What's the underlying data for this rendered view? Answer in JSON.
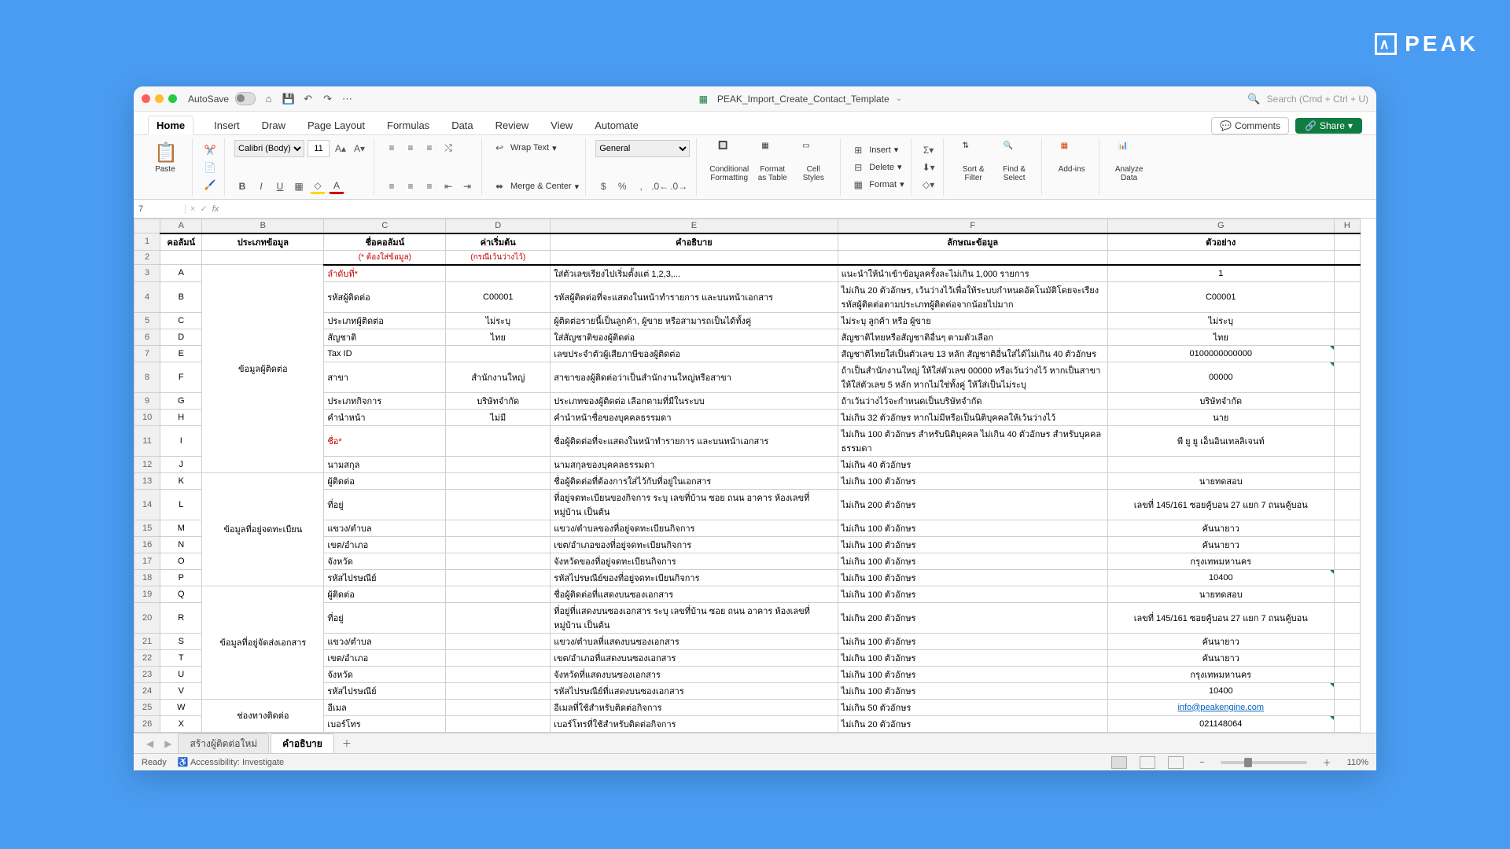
{
  "brand": "PEAK",
  "titlebar": {
    "autosave": "AutoSave",
    "filename": "PEAK_Import_Create_Contact_Template",
    "search_placeholder": "Search (Cmd + Ctrl + U)"
  },
  "menu": {
    "tabs": [
      "Home",
      "Insert",
      "Draw",
      "Page Layout",
      "Formulas",
      "Data",
      "Review",
      "View",
      "Automate"
    ],
    "comments": "Comments",
    "share": "Share"
  },
  "ribbon": {
    "paste": "Paste",
    "font_name": "Calibri (Body)",
    "font_size": "11",
    "wrap_text": "Wrap Text",
    "merge_center": "Merge & Center",
    "number_format": "General",
    "cond_fmt": "Conditional\nFormatting",
    "fmt_table": "Format\nas Table",
    "cell_styles": "Cell\nStyles",
    "insert": "Insert",
    "delete": "Delete",
    "format": "Format",
    "sort_filter": "Sort &\nFilter",
    "find_select": "Find &\nSelect",
    "addins": "Add-ins",
    "analyze": "Analyze\nData"
  },
  "fxbar": {
    "cell": "7",
    "fx": "fx"
  },
  "col_letters": [
    "",
    "A",
    "B",
    "C",
    "D",
    "E",
    "F",
    "G",
    "H"
  ],
  "header1": {
    "a": "คอลัมน์",
    "b": "ประเภทข้อมูล",
    "c": "ชื่อคอลัมน์",
    "d": "ค่าเริ่มต้น",
    "e": "คำอธิบาย",
    "f": "ลักษณะข้อมูล",
    "g": "ตัวอย่าง"
  },
  "header2": {
    "c": "(* ต้องใส่ข้อมูล)",
    "d": "(กรณีเว้นว่างไว้)"
  },
  "groups": {
    "g1": "ข้อมูลผู้ติดต่อ",
    "g2": "ข้อมูลที่อยู่จดทะเบียน",
    "g3": "ข้อมูลที่อยู่จัดส่งเอกสาร",
    "g4": "ช่องทางติดต่อ"
  },
  "rows": [
    {
      "a": "A",
      "c": "ลำดับที่*",
      "c_red": true,
      "d": "",
      "e": "ใส่ตัวเลขเรียงไปเริ่มตั้งแต่ 1,2,3,...",
      "f": "แนะนำให้นำเข้าข้อมูลครั้งละไม่เกิน 1,000 รายการ",
      "g": "1"
    },
    {
      "a": "B",
      "c": "รหัสผู้ติดต่อ",
      "d": "C00001",
      "e": "รหัสผู้ติดต่อที่จะแสดงในหน้าทำรายการ และบนหน้าเอกสาร",
      "f": "ไม่เกิน 20 ตัวอักษร, เว้นว่างไว้เพื่อให้ระบบกำหนดอัตโนมัติโดยจะเรียงรหัสผู้ติดต่อตามประเภทผู้ติดต่อจากน้อยไปมาก",
      "g": "C00001"
    },
    {
      "a": "C",
      "c": "ประเภทผู้ติดต่อ",
      "d": "ไม่ระบุ",
      "e": "ผู้ติดต่อรายนี้เป็นลูกค้า, ผู้ขาย หรือสามารถเป็นได้ทั้งคู่",
      "f": "ไม่ระบุ ลูกค้า หรือ ผู้ขาย",
      "g": "ไม่ระบุ"
    },
    {
      "a": "D",
      "c": "สัญชาติ",
      "d": "ไทย",
      "e": "ใส่สัญชาติของผู้ติดต่อ",
      "f": "สัญชาติไทยหรือสัญชาติอื่นๆ ตามตัวเลือก",
      "g": "ไทย"
    },
    {
      "a": "E",
      "c": "Tax ID",
      "d": "",
      "e": "เลขประจำตัวผู้เสียภาษีของผู้ติดต่อ",
      "f": "สัญชาติไทยใส่เป็นตัวเลข 13 หลัก สัญชาติอื่นใส่ได้ไม่เกิน 40 ตัวอักษร",
      "g": "0100000000000",
      "tri": true
    },
    {
      "a": "F",
      "c": "สาขา",
      "d": "สำนักงานใหญ่",
      "e": "สาขาของผู้ติดต่อว่าเป็นสำนักงานใหญ่หรือสาขา",
      "f": "ถ้าเป็นสำนักงานใหญ่ ให้ใส่ตัวเลข 00000 หรือเว้นว่างไว้ หากเป็นสาขา ให้ใส่ตัวเลข 5 หลัก หากไม่ใช่ทั้งคู่ ให้ใส่เป็นไม่ระบุ",
      "g": "00000",
      "tri": true
    },
    {
      "a": "G",
      "c": "ประเภทกิจการ",
      "d": "บริษัทจำกัด",
      "e": "ประเภทของผู้ติดต่อ เลือกตามที่มีในระบบ",
      "f": "ถ้าเว้นว่างไว้จะกำหนดเป็นบริษัทจำกัด",
      "g": "บริษัทจำกัด"
    },
    {
      "a": "H",
      "c": "คำนำหน้า",
      "d": "ไม่มี",
      "e": "คำนำหน้าชื่อของบุคคลธรรมดา",
      "f": "ไม่เกิน 32 ตัวอักษร หากไม่มีหรือเป็นนิติบุคคลให้เว้นว่างไว้",
      "g": "นาย"
    },
    {
      "a": "I",
      "c": "ชื่อ*",
      "c_red": true,
      "d": "",
      "e": "ชื่อผู้ติดต่อที่จะแสดงในหน้าทำรายการ และบนหน้าเอกสาร",
      "f": "ไม่เกิน 100 ตัวอักษร สำหรับนิติบุคคล ไม่เกิน 40 ตัวอักษร สำหรับบุคคลธรรมดา",
      "g": "พี ยู ยู เอ็นอินเทลลิเจนท์"
    },
    {
      "a": "J",
      "c": "นามสกุล",
      "d": "",
      "e": "นามสกุลของบุคคลธรรมดา",
      "f": "ไม่เกิน 40 ตัวอักษร",
      "g": ""
    },
    {
      "a": "K",
      "c": "ผู้ติดต่อ",
      "d": "",
      "e": "ชื่อผู้ติดต่อที่ต้องการใส่ไว้กับที่อยู่ในเอกสาร",
      "f": "ไม่เกิน 100 ตัวอักษร",
      "g": "นายทดสอบ"
    },
    {
      "a": "L",
      "c": "ที่อยู่",
      "d": "",
      "e": "ที่อยู่จดทะเบียนของกิจการ ระบุ เลขที่บ้าน ซอย ถนน อาคาร ห้องเลขที่ หมู่บ้าน เป็นต้น",
      "f": "ไม่เกิน 200 ตัวอักษร",
      "g": "เลขที่ 145/161 ซอยคู้บอน 27 แยก 7 ถนนคู้บอน"
    },
    {
      "a": "M",
      "c": "แขวง/ตำบล",
      "d": "",
      "e": "แขวง/ตำบลของที่อยู่จดทะเบียนกิจการ",
      "f": "ไม่เกิน 100 ตัวอักษร",
      "g": "คันนายาว"
    },
    {
      "a": "N",
      "c": "เขต/อำเภอ",
      "d": "",
      "e": "เขต/อำเภอของที่อยู่จดทะเบียนกิจการ",
      "f": "ไม่เกิน 100 ตัวอักษร",
      "g": "คันนายาว"
    },
    {
      "a": "O",
      "c": "จังหวัด",
      "d": "",
      "e": "จังหวัดของที่อยู่จดทะเบียนกิจการ",
      "f": "ไม่เกิน 100 ตัวอักษร",
      "g": "กรุงเทพมหานคร"
    },
    {
      "a": "P",
      "c": "รหัสไปรษณีย์",
      "d": "",
      "e": "รหัสไปรษณีย์ของที่อยู่จดทะเบียนกิจการ",
      "f": "ไม่เกิน 100 ตัวอักษร",
      "g": "10400",
      "tri": true
    },
    {
      "a": "Q",
      "c": "ผู้ติดต่อ",
      "d": "",
      "e": "ชื่อผู้ติดต่อที่แสดงบนซองเอกสาร",
      "f": "ไม่เกิน 100 ตัวอักษร",
      "g": "นายทดสอบ"
    },
    {
      "a": "R",
      "c": "ที่อยู่",
      "d": "",
      "e": "ที่อยู่ที่แสดงบนซองเอกสาร ระบุ เลขที่บ้าน ซอย ถนน อาคาร ห้องเลขที่ หมู่บ้าน เป็นต้น",
      "f": "ไม่เกิน 200 ตัวอักษร",
      "g": "เลขที่ 145/161 ซอยคู้บอน 27 แยก 7 ถนนคู้บอน"
    },
    {
      "a": "S",
      "c": "แขวง/ตำบล",
      "d": "",
      "e": "แขวง/ตำบลที่แสดงบนซองเอกสาร",
      "f": "ไม่เกิน 100 ตัวอักษร",
      "g": "คันนายาว"
    },
    {
      "a": "T",
      "c": "เขต/อำเภอ",
      "d": "",
      "e": "เขต/อำเภอที่แสดงบนซองเอกสาร",
      "f": "ไม่เกิน 100 ตัวอักษร",
      "g": "คันนายาว"
    },
    {
      "a": "U",
      "c": "จังหวัด",
      "d": "",
      "e": "จังหวัดที่แสดงบนซองเอกสาร",
      "f": "ไม่เกิน 100 ตัวอักษร",
      "g": "กรุงเทพมหานคร"
    },
    {
      "a": "V",
      "c": "รหัสไปรษณีย์",
      "d": "",
      "e": "รหัสไปรษณีย์ที่แสดงบนซองเอกสาร",
      "f": "ไม่เกิน 100 ตัวอักษร",
      "g": "10400",
      "tri": true
    },
    {
      "a": "W",
      "c": "อีเมล",
      "d": "",
      "e": "อีเมลที่ใช้สำหรับติดต่อกิจการ",
      "f": "ไม่เกิน 50 ตัวอักษร",
      "g": "info@peakengine.com",
      "link": true
    },
    {
      "a": "X",
      "c": "เบอร์โทร",
      "d": "",
      "e": "เบอร์โทรที่ใช้สำหรับติดต่อกิจการ",
      "f": "ไม่เกิน 20 ตัวอักษร",
      "g": "021148064",
      "tri": true
    }
  ],
  "sheets": {
    "tab1": "สร้างผู้ติดต่อใหม่",
    "tab2": "คำอธิบาย"
  },
  "status": {
    "ready": "Ready",
    "acc": "Accessibility: Investigate",
    "zoom": "110%"
  }
}
